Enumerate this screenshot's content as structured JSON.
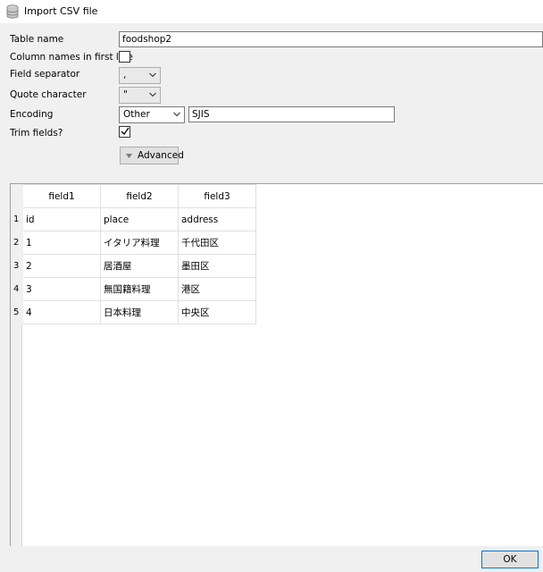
{
  "window": {
    "title": "Import CSV file",
    "icon": "database-icon"
  },
  "form": {
    "table_name_label": "Table name",
    "table_name_value": "foodshop2",
    "column_names_label": "Column names in first line",
    "column_names_checked": false,
    "field_separator_label": "Field separator",
    "field_separator_value": ",",
    "quote_character_label": "Quote character",
    "quote_character_value": "\"",
    "encoding_label": "Encoding",
    "encoding_value": "Other",
    "encoding_custom_value": "SJIS",
    "trim_fields_label": "Trim fields?",
    "trim_fields_checked": true,
    "advanced_label": "Advanced"
  },
  "preview": {
    "columns": [
      "field1",
      "field2",
      "field3"
    ],
    "rows": [
      {
        "num": "1",
        "cells": [
          "id",
          "place",
          "address"
        ]
      },
      {
        "num": "2",
        "cells": [
          "1",
          "イタリア料理",
          "千代田区"
        ]
      },
      {
        "num": "3",
        "cells": [
          "2",
          "居酒屋",
          "墨田区"
        ]
      },
      {
        "num": "4",
        "cells": [
          "3",
          "無国籍料理",
          "港区"
        ]
      },
      {
        "num": "5",
        "cells": [
          "4",
          "日本料理",
          "中央区"
        ]
      }
    ]
  },
  "footer": {
    "ok_label": "OK"
  }
}
